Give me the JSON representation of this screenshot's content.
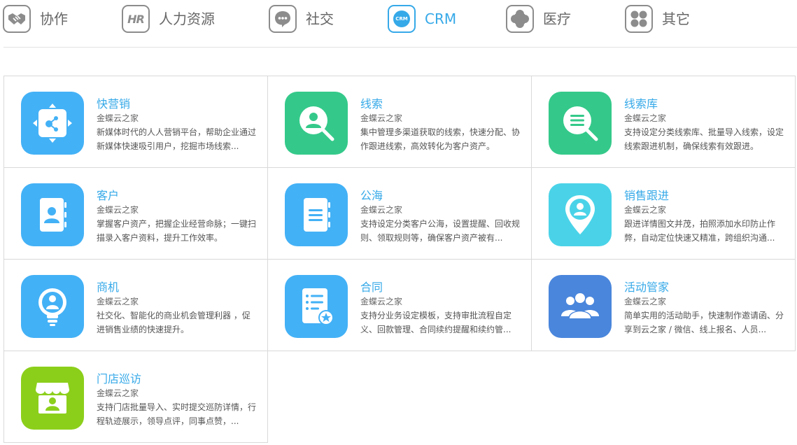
{
  "tabs": [
    {
      "label": "协作",
      "icon": "handshake-icon",
      "active": false
    },
    {
      "label": "人力资源",
      "icon": "hr-icon",
      "icon_text": "HR",
      "active": false
    },
    {
      "label": "社交",
      "icon": "chat-bubble-icon",
      "active": false
    },
    {
      "label": "CRM",
      "icon": "crm-icon",
      "icon_text": "CRM",
      "active": true
    },
    {
      "label": "医疗",
      "icon": "medical-cross-icon",
      "active": false
    },
    {
      "label": "其它",
      "icon": "four-dots-icon",
      "active": false
    }
  ],
  "colors": {
    "accent": "#36a9e8",
    "blue": "#43b1f6",
    "green": "#34c98a",
    "cyan": "#4ad3e8",
    "darkblue": "#4a86dc",
    "lime": "#8ccf1b"
  },
  "apps": [
    {
      "name": "快营销",
      "vendor": "金蝶云之家",
      "desc": "新媒体时代的人人营销平台，帮助企业通过新媒体快速吸引用户，挖掘市场线索...",
      "icon": "share-nodes-icon",
      "color": "#43b1f6"
    },
    {
      "name": "线索",
      "vendor": "金蝶云之家",
      "desc": "集中管理多渠道获取的线索，快速分配、协作跟进线索，高效转化为客户资产。",
      "icon": "search-person-icon",
      "color": "#34c98a"
    },
    {
      "name": "线索库",
      "vendor": "金蝶云之家",
      "desc": "支持设定分类线索库、批量导入线索，设定线索跟进机制，确保线索有效跟进。",
      "icon": "search-list-icon",
      "color": "#34c98a"
    },
    {
      "name": "客户",
      "vendor": "金蝶云之家",
      "desc": "掌握客户资产，把握企业经营命脉；一键扫描录入客户资料，提升工作效率。",
      "icon": "contact-book-icon",
      "color": "#43b1f6"
    },
    {
      "name": "公海",
      "vendor": "金蝶云之家",
      "desc": "支持设定分类客户公海，设置提醒、回收规则、领取规则等，确保客户资产被有...",
      "icon": "notebook-icon",
      "color": "#43b1f6"
    },
    {
      "name": "销售跟进",
      "vendor": "金蝶云之家",
      "desc": "跟进详情图文并茂，拍照添加水印防止作弊，自动定位快速又精准，跨组织沟通...",
      "icon": "location-person-icon",
      "color": "#4ad3e8"
    },
    {
      "name": "商机",
      "vendor": "金蝶云之家",
      "desc": "社交化、智能化的商业机会管理利器 ，促进销售业绩的快速提升。",
      "icon": "lightbulb-person-icon",
      "color": "#43b1f6"
    },
    {
      "name": "合同",
      "vendor": "金蝶云之家",
      "desc": "支持分业务设定模板，支持审批流程自定义、回款管理、合同续约提醒和续约管...",
      "icon": "contract-star-icon",
      "color": "#43b1f6"
    },
    {
      "name": "活动管家",
      "vendor": "金蝶云之家",
      "desc": "简单实用的活动助手，快速制作邀请函、分享到云之家 / 微信、线上报名、人员...",
      "icon": "group-people-icon",
      "color": "#4a86dc"
    },
    {
      "name": "门店巡访",
      "vendor": "金蝶云之家",
      "desc": "支持门店批量导入、实时提交巡防详情，行程轨迹展示，领导点评，同事点赞，...",
      "icon": "store-person-icon",
      "color": "#8ccf1b"
    }
  ]
}
